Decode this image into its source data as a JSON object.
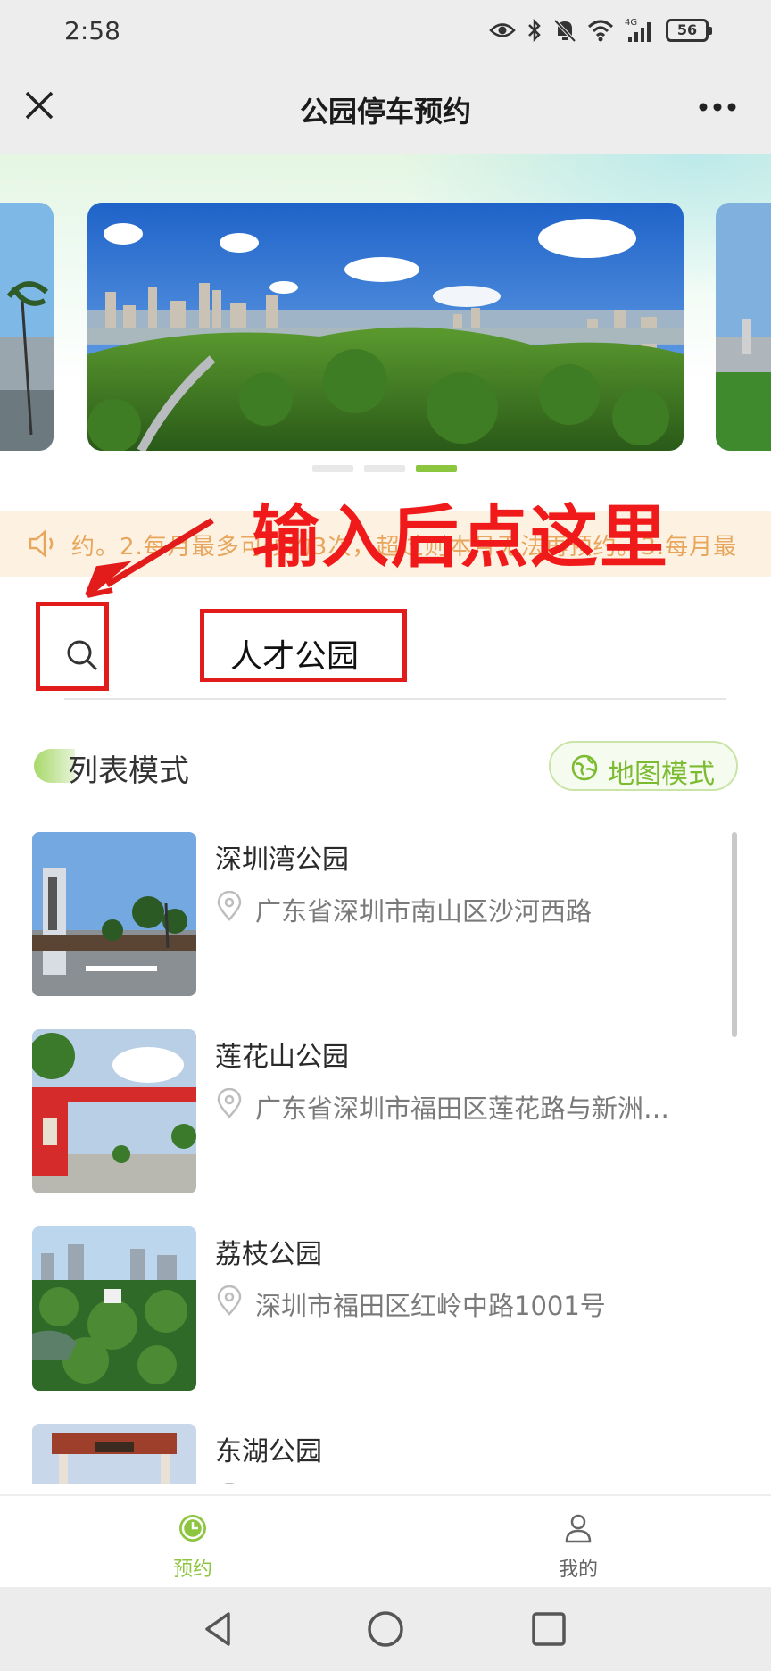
{
  "status_bar": {
    "time": "2:58",
    "battery": "56",
    "network": "4G"
  },
  "header": {
    "title": "公园停车预约",
    "close_icon": "close-icon",
    "more_icon": "more-dots-icon"
  },
  "banner": {
    "slide_count": 3,
    "active_slide": 3
  },
  "notice": {
    "text": "约。2.每月最多可预约3次，超过则本月无法再预约。3.每月最"
  },
  "annotation": {
    "text": "输入后点这里",
    "color": "#f01a1a"
  },
  "search": {
    "value": "人才公园",
    "icon": "search-icon"
  },
  "list_header": {
    "title": "列表模式",
    "map_button_label": "地图模式"
  },
  "parks": [
    {
      "name": "深圳湾公园",
      "address": "广东省深圳市南山区沙河西路"
    },
    {
      "name": "莲花山公园",
      "address": "广东省深圳市福田区莲花路与新洲…"
    },
    {
      "name": "荔枝公园",
      "address": "深圳市福田区红岭中路1001号"
    },
    {
      "name": "东湖公园",
      "address": ""
    }
  ],
  "tabs": {
    "book_label": "预约",
    "mine_label": "我的"
  },
  "colors": {
    "accent": "#8cc63f",
    "notice_text": "#e8a55c",
    "notice_bg": "#fdf2e2"
  }
}
